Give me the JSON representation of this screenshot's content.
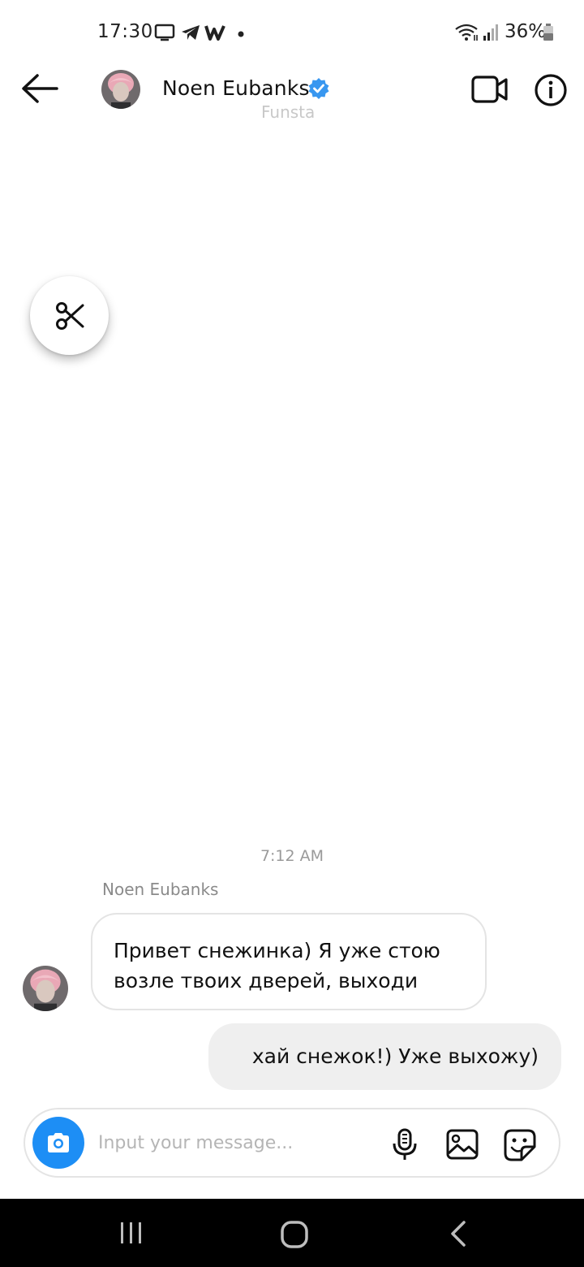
{
  "status_bar": {
    "time": "17:30",
    "battery": "36%",
    "icons": [
      "monitor-icon",
      "telegram-icon",
      "w-app-icon",
      "dot-icon",
      "wifi-icon",
      "signal-icon",
      "battery-icon"
    ]
  },
  "header": {
    "contact_name": "Noen Eubanks",
    "subtitle": "Funsta",
    "verified_color": "#3897f0"
  },
  "chat": {
    "timestamp": "7:12 AM",
    "sender_name": "Noen Eubanks",
    "messages": [
      {
        "direction": "incoming",
        "lines": [
          "Привет снежинка) Я уже стою",
          "возле твоих дверей, выходи"
        ]
      },
      {
        "direction": "outgoing",
        "text": "хай снежок!) Уже выхожу)"
      }
    ]
  },
  "composer": {
    "placeholder": "Input your message...",
    "value": "",
    "camera_color": "#1d8ef5"
  },
  "nav_bar": {
    "buttons": [
      "recents-icon",
      "home-icon",
      "back-icon"
    ]
  }
}
